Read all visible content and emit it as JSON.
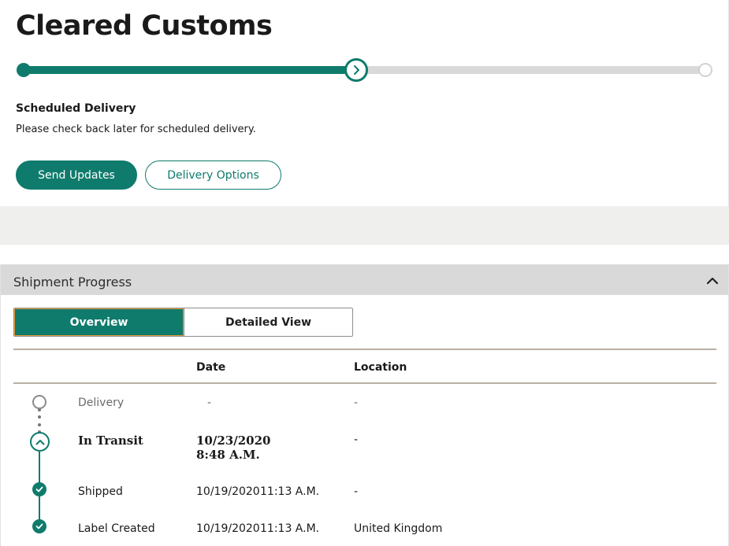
{
  "status": {
    "title": "Cleared Customs",
    "progress_fraction": 0.49,
    "scheduled_title": "Scheduled Delivery",
    "scheduled_text": "Please check back later for scheduled delivery.",
    "send_updates_label": "Send Updates",
    "delivery_options_label": "Delivery Options",
    "accent_color": "#0f7b6c"
  },
  "shipment_progress": {
    "title": "Shipment Progress",
    "tabs": [
      {
        "label": "Overview",
        "active": true
      },
      {
        "label": "Detailed View",
        "active": false
      }
    ],
    "columns": {
      "date": "Date",
      "location": "Location"
    },
    "events": [
      {
        "status": "Delivery",
        "date": "-",
        "time": "",
        "location": "-",
        "state": "pending"
      },
      {
        "status": "In Transit",
        "date": "10/23/2020",
        "time": "8:48 A.M.",
        "location": "-",
        "state": "current"
      },
      {
        "status": "Shipped",
        "date": "10/19/2020",
        "time": "11:13 A.M.",
        "location": "-",
        "state": "done"
      },
      {
        "status": "Label Created",
        "date": "10/19/2020",
        "time": "11:13 A.M.",
        "location": "United Kingdom",
        "state": "done"
      }
    ]
  },
  "icons": {
    "progress_current": "chevron-right-icon",
    "collapse": "chevron-up-icon",
    "timeline_current": "chevron-up-icon",
    "timeline_done": "check-icon",
    "timeline_pending": "circle-outline-icon"
  }
}
